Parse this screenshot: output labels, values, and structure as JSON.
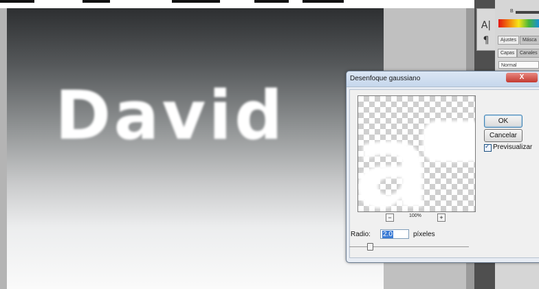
{
  "canvas": {
    "text": "David"
  },
  "panels": {
    "tool_icons": [
      "type-icon",
      "paragraph-icon"
    ],
    "color_slider_label": "B",
    "tabs_row1": [
      "Ajustes",
      "Másca"
    ],
    "tabs_row2": [
      "Capas",
      "Canales"
    ],
    "blend_mode": "Normal",
    "close_glyph": "X"
  },
  "dialog": {
    "title": "Desenfoque gaussiano",
    "preview_letter": "a",
    "zoom_out": "−",
    "zoom_in": "+",
    "zoom_level": "100%",
    "ok_label": "OK",
    "cancel_label": "Cancelar",
    "preview_checkbox_label": "Previsualizar",
    "preview_checked": true,
    "radius_label": "Radio:",
    "radius_value": "2.0",
    "radius_unit": "píxeles"
  },
  "colors": {
    "dialog_bg": "#f0f0f0",
    "titlebar": "#c6d7ec",
    "selection": "#3a7bd5"
  }
}
